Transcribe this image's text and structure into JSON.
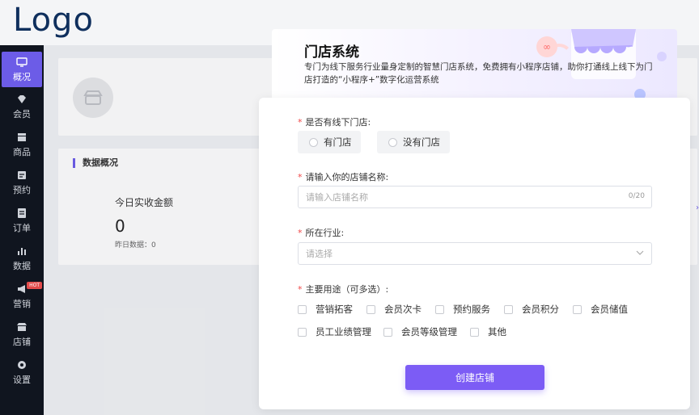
{
  "logo": "Logo",
  "sidebar": {
    "items": [
      {
        "label": "概况",
        "icon": "monitor-icon",
        "active": true
      },
      {
        "label": "会员",
        "icon": "diamond-icon"
      },
      {
        "label": "商品",
        "icon": "box-icon"
      },
      {
        "label": "预约",
        "icon": "calendar-icon"
      },
      {
        "label": "订单",
        "icon": "order-icon"
      },
      {
        "label": "数据",
        "icon": "bar-chart-icon"
      },
      {
        "label": "营销",
        "icon": "megaphone-icon",
        "badge": "HOT"
      },
      {
        "label": "店铺",
        "icon": "store-icon"
      },
      {
        "label": "设置",
        "icon": "gear-icon"
      }
    ]
  },
  "main": {
    "section_title": "数据概况",
    "kpi_label": "今日实收金额",
    "kpi_value": "0",
    "kpi_sub": "昨日数据：0"
  },
  "modal": {
    "title": "门店系统",
    "description": "专门为线下服务行业量身定制的智慧门店系统，免费拥有小程序店铺，助你打通线上线下为门店打造的“小程序+”数字化运营系统",
    "has_store_label": "是否有线下门店:",
    "has_store_options": [
      "有门店",
      "没有门店"
    ],
    "store_name_label": "请输入你的店铺名称:",
    "store_name_placeholder": "请输入店铺名称",
    "store_name_count": "0/20",
    "industry_label": "所在行业:",
    "industry_placeholder": "请选择",
    "usage_label": "主要用途（可多选）:",
    "usage_options": [
      "营销拓客",
      "会员次卡",
      "预约服务",
      "会员积分",
      "会员储值",
      "员工业绩管理",
      "会员等级管理",
      "其他"
    ],
    "create_button": "创建店铺",
    "accent": "#7c5cf5"
  }
}
